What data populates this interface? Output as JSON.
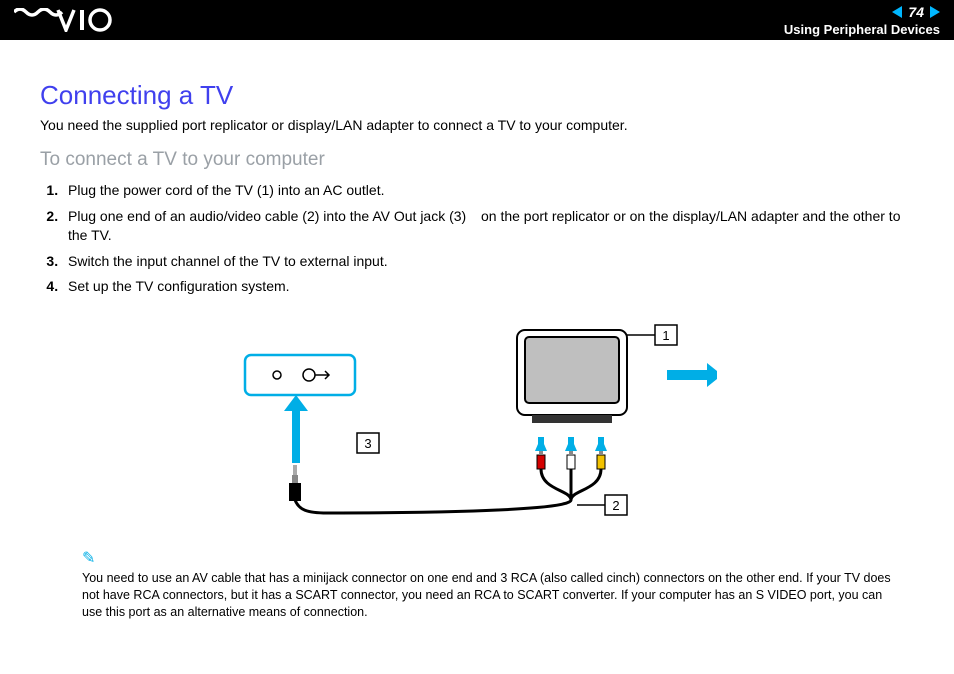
{
  "header": {
    "page_number": "74",
    "section": "Using Peripheral Devices"
  },
  "page": {
    "title": "Connecting a TV",
    "intro": "You need the supplied port replicator or display/LAN adapter to connect a TV to your computer.",
    "subheading": "To connect a TV to your computer",
    "steps": [
      "Plug the power cord of the TV (1) into an AC outlet.",
      "Plug one end of an audio/video cable (2) into the AV Out jack (3)   on the port replicator or on the display/LAN adapter and the other to the TV.",
      "Switch the input channel of the TV to external input.",
      "Set up the TV configuration system."
    ],
    "note": "You need to use an AV cable that has a minijack connector on one end and 3 RCA (also called cinch) connectors on the other end. If your TV does not have RCA connectors, but it has a SCART connector, you need an RCA to SCART converter. If your computer has an S VIDEO port, you can use this port as an alternative means of connection."
  },
  "diagram": {
    "callouts": {
      "c1": "1",
      "c2": "2",
      "c3": "3"
    }
  }
}
